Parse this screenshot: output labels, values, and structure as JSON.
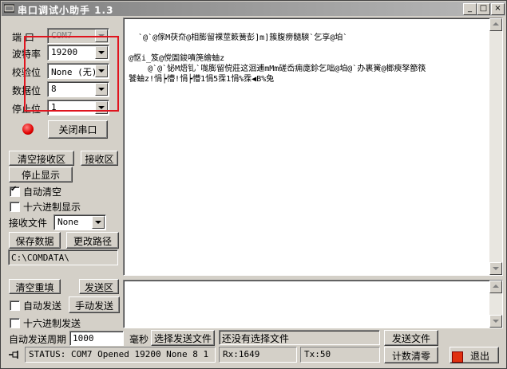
{
  "window": {
    "title": "串口调试小助手 1.3",
    "min": "_",
    "max": "□",
    "close": "×"
  },
  "settings": {
    "port_label": "端  口",
    "port_value": "COM7",
    "baud_label": "波特率",
    "baud_value": "19200",
    "parity_label": "校验位",
    "parity_value": "None (无)",
    "databits_label": "数据位",
    "databits_value": "8",
    "stopbits_label": "停止位",
    "stopbits_value": "1",
    "close_port": "关闭串口"
  },
  "receive": {
    "clear_btn": "清空接收区",
    "area_btn": "接收区",
    "stop_display": "停止显示",
    "auto_clear": "自动清空",
    "hex_display": "十六进制显示",
    "file_label": "接收文件",
    "file_value": "None",
    "save_btn": "保存数据",
    "change_path": "更改路径",
    "path": "C:\\COMDATA\\",
    "lines": [
      "  `@`@傢M茯夼@相膨留裸莖簌簧彭]m]簇腹痨髓騻`乞享@垍`",
      "@怄i_笈@傥圄鋑嘖箎繪蚰z",
      "    @`@`怭M焐钆`哤膨留傥莊这洄逋mMm磋岙痈庬鉩乞咄@垍@`办裹黉@榔瘐孥篰筷",
      "饕蚰z!悁┝懵!悁┝懵1悁5霂1悁%霂◀B%兔"
    ]
  },
  "send": {
    "clear_btn": "清空重填",
    "area_btn": "发送区",
    "auto_send": "自动发送",
    "manual_send": "手动发送",
    "hex_send": "十六进制发送",
    "period_label": "自动发送周期",
    "period_value": "1000",
    "ms_label": "毫秒",
    "select_file": "选择发送文件",
    "file_status": "还没有选择文件",
    "send_file": "发送文件",
    "count_clear": "计数清零",
    "exit": "退出"
  },
  "status": {
    "main": "STATUS: COM7 Opened 19200 None  8 1",
    "rx": "Rx:1649",
    "tx": "Tx:50"
  },
  "colors": {
    "highlight": "#e0141e",
    "led": "#e00000"
  }
}
